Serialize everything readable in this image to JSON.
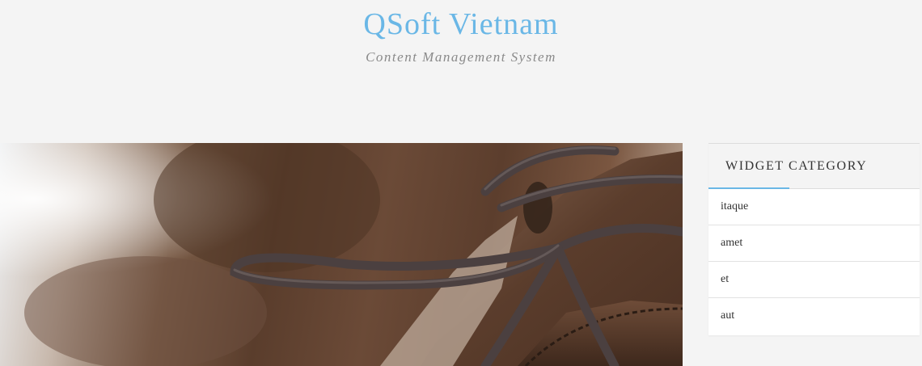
{
  "header": {
    "site_title": "QSoft Vietnam",
    "tagline": "Content Management System"
  },
  "featured_image": {
    "subject": "shoe-laces-photo"
  },
  "sidebar": {
    "widget_title": "WIDGET CATEGORY",
    "categories": [
      {
        "label": "itaque"
      },
      {
        "label": "amet"
      },
      {
        "label": "et"
      },
      {
        "label": "aut"
      }
    ]
  },
  "colors": {
    "accent": "#6ab7e6",
    "background": "#f4f4f4",
    "tagline": "#8a8a8a",
    "text": "#333333"
  }
}
